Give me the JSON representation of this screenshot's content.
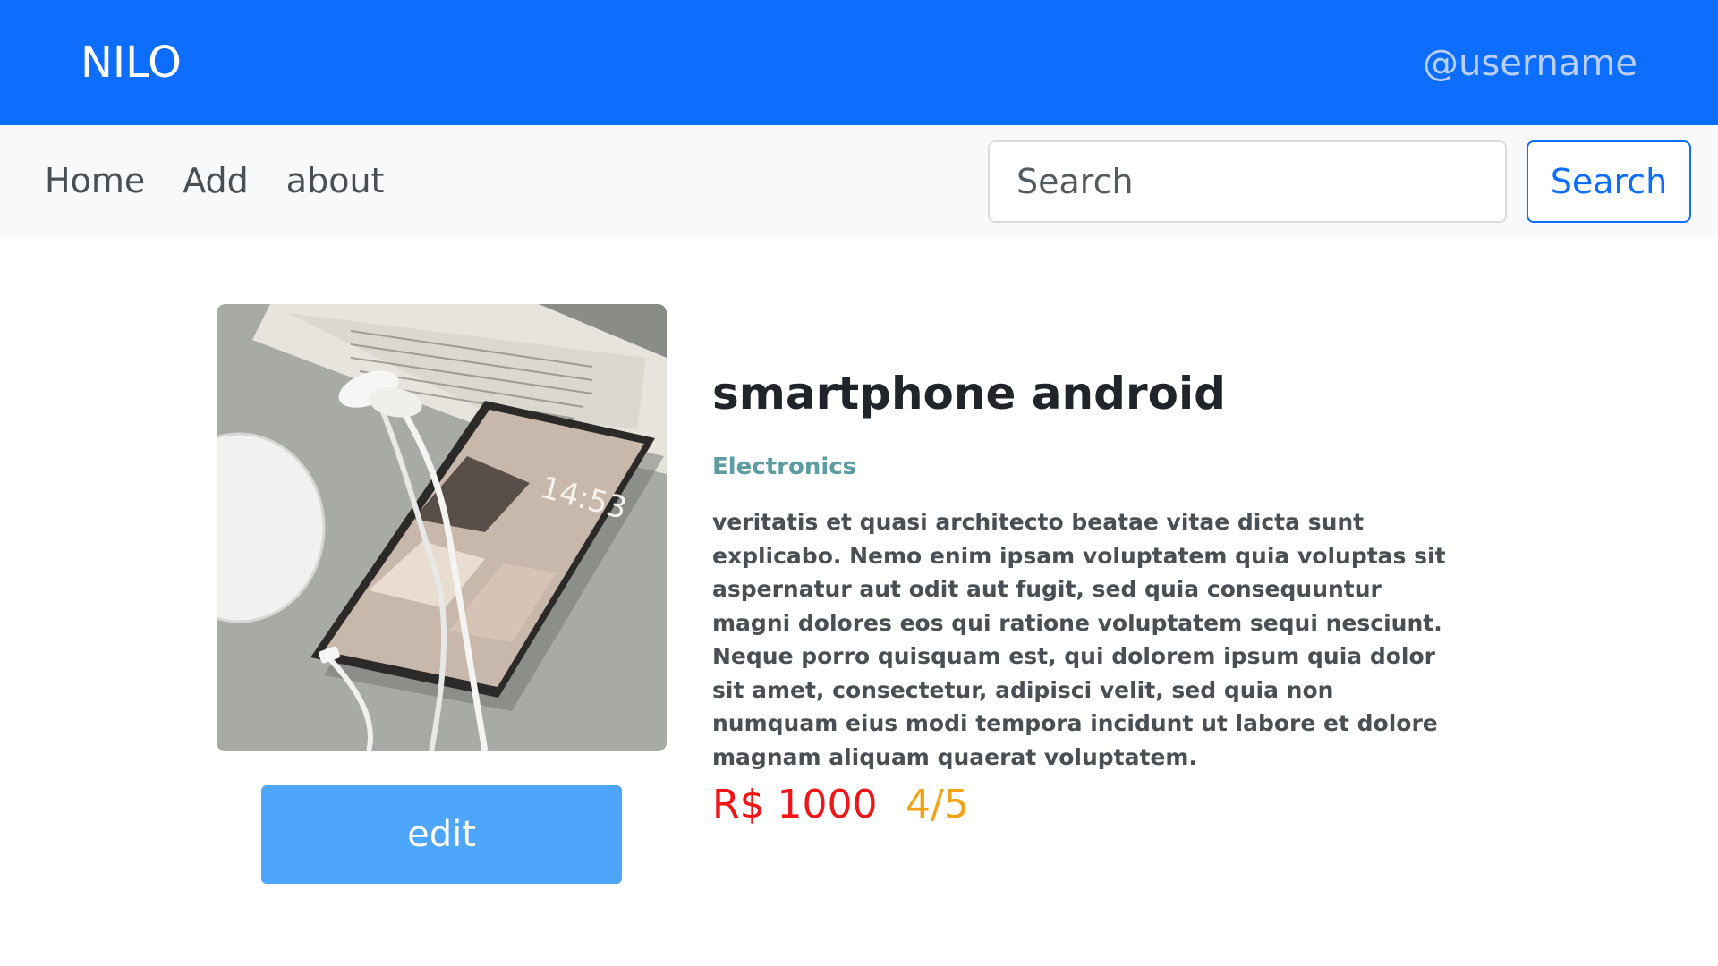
{
  "header": {
    "brand": "NILO",
    "username": "@username"
  },
  "nav": {
    "links": [
      "Home",
      "Add",
      "about"
    ],
    "search_placeholder": "Search",
    "search_button": "Search"
  },
  "product": {
    "image_icon": "smartphone-with-earphones-photo",
    "title": "smartphone android",
    "category": "Electronics",
    "description": "veritatis et quasi architecto beatae vitae dicta sunt explicabo. Nemo enim ipsam voluptatem quia voluptas sit aspernatur aut odit aut fugit, sed quia consequuntur magni dolores eos qui ratione voluptatem sequi nesciunt. Neque porro quisquam est, qui dolorem ipsum quia dolor sit amet, consectetur, adipisci velit, sed quia non numquam eius modi tempora incidunt ut labore et dolore magnam aliquam quaerat voluptatem.",
    "price": "R$ 1000",
    "rating": "4/5",
    "edit_label": "edit"
  },
  "colors": {
    "header_bg": "#0d6efd",
    "price": "#f01616",
    "rating": "#f2a216",
    "category": "#5b9da1",
    "edit_button": "#4ea6fb"
  }
}
